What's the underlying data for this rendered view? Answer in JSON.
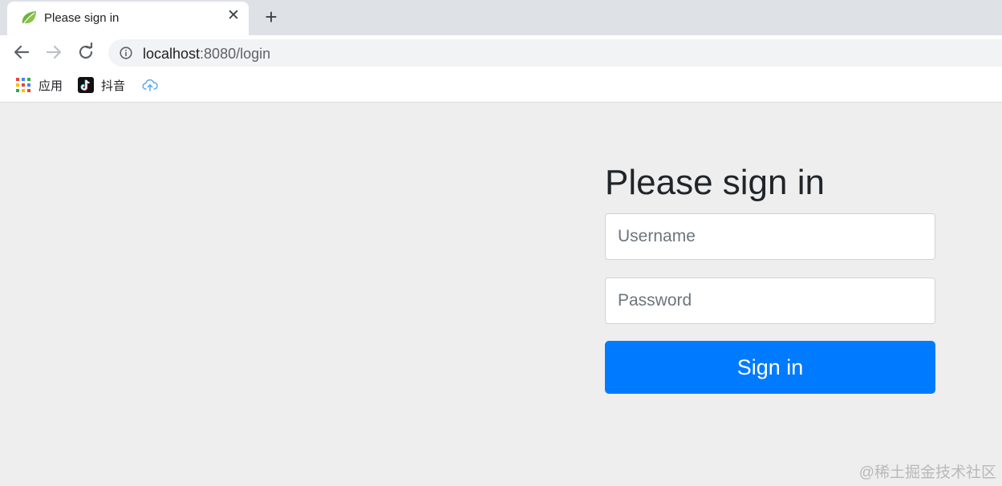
{
  "browser": {
    "tab": {
      "title": "Please sign in",
      "favicon": "spring-leaf-icon",
      "close_glyph": "✕"
    },
    "new_tab_glyph": "+",
    "address_bar": {
      "host": "localhost",
      "rest": ":8080/login"
    },
    "bookmarks": [
      {
        "label": "应用",
        "icon": "apps-grid-icon"
      },
      {
        "label": "抖音",
        "icon": "douyin-icon"
      },
      {
        "label": "",
        "icon": "cloud-upload-icon"
      }
    ]
  },
  "login": {
    "heading": "Please sign in",
    "username_placeholder": "Username",
    "username_value": "",
    "password_placeholder": "Password",
    "password_value": "",
    "submit_label": "Sign in"
  },
  "watermark": "@稀土掘金技术社区",
  "colors": {
    "primary_button": "#007bff",
    "page_background": "#eeeeee",
    "tabstrip_background": "#dee1e6"
  }
}
